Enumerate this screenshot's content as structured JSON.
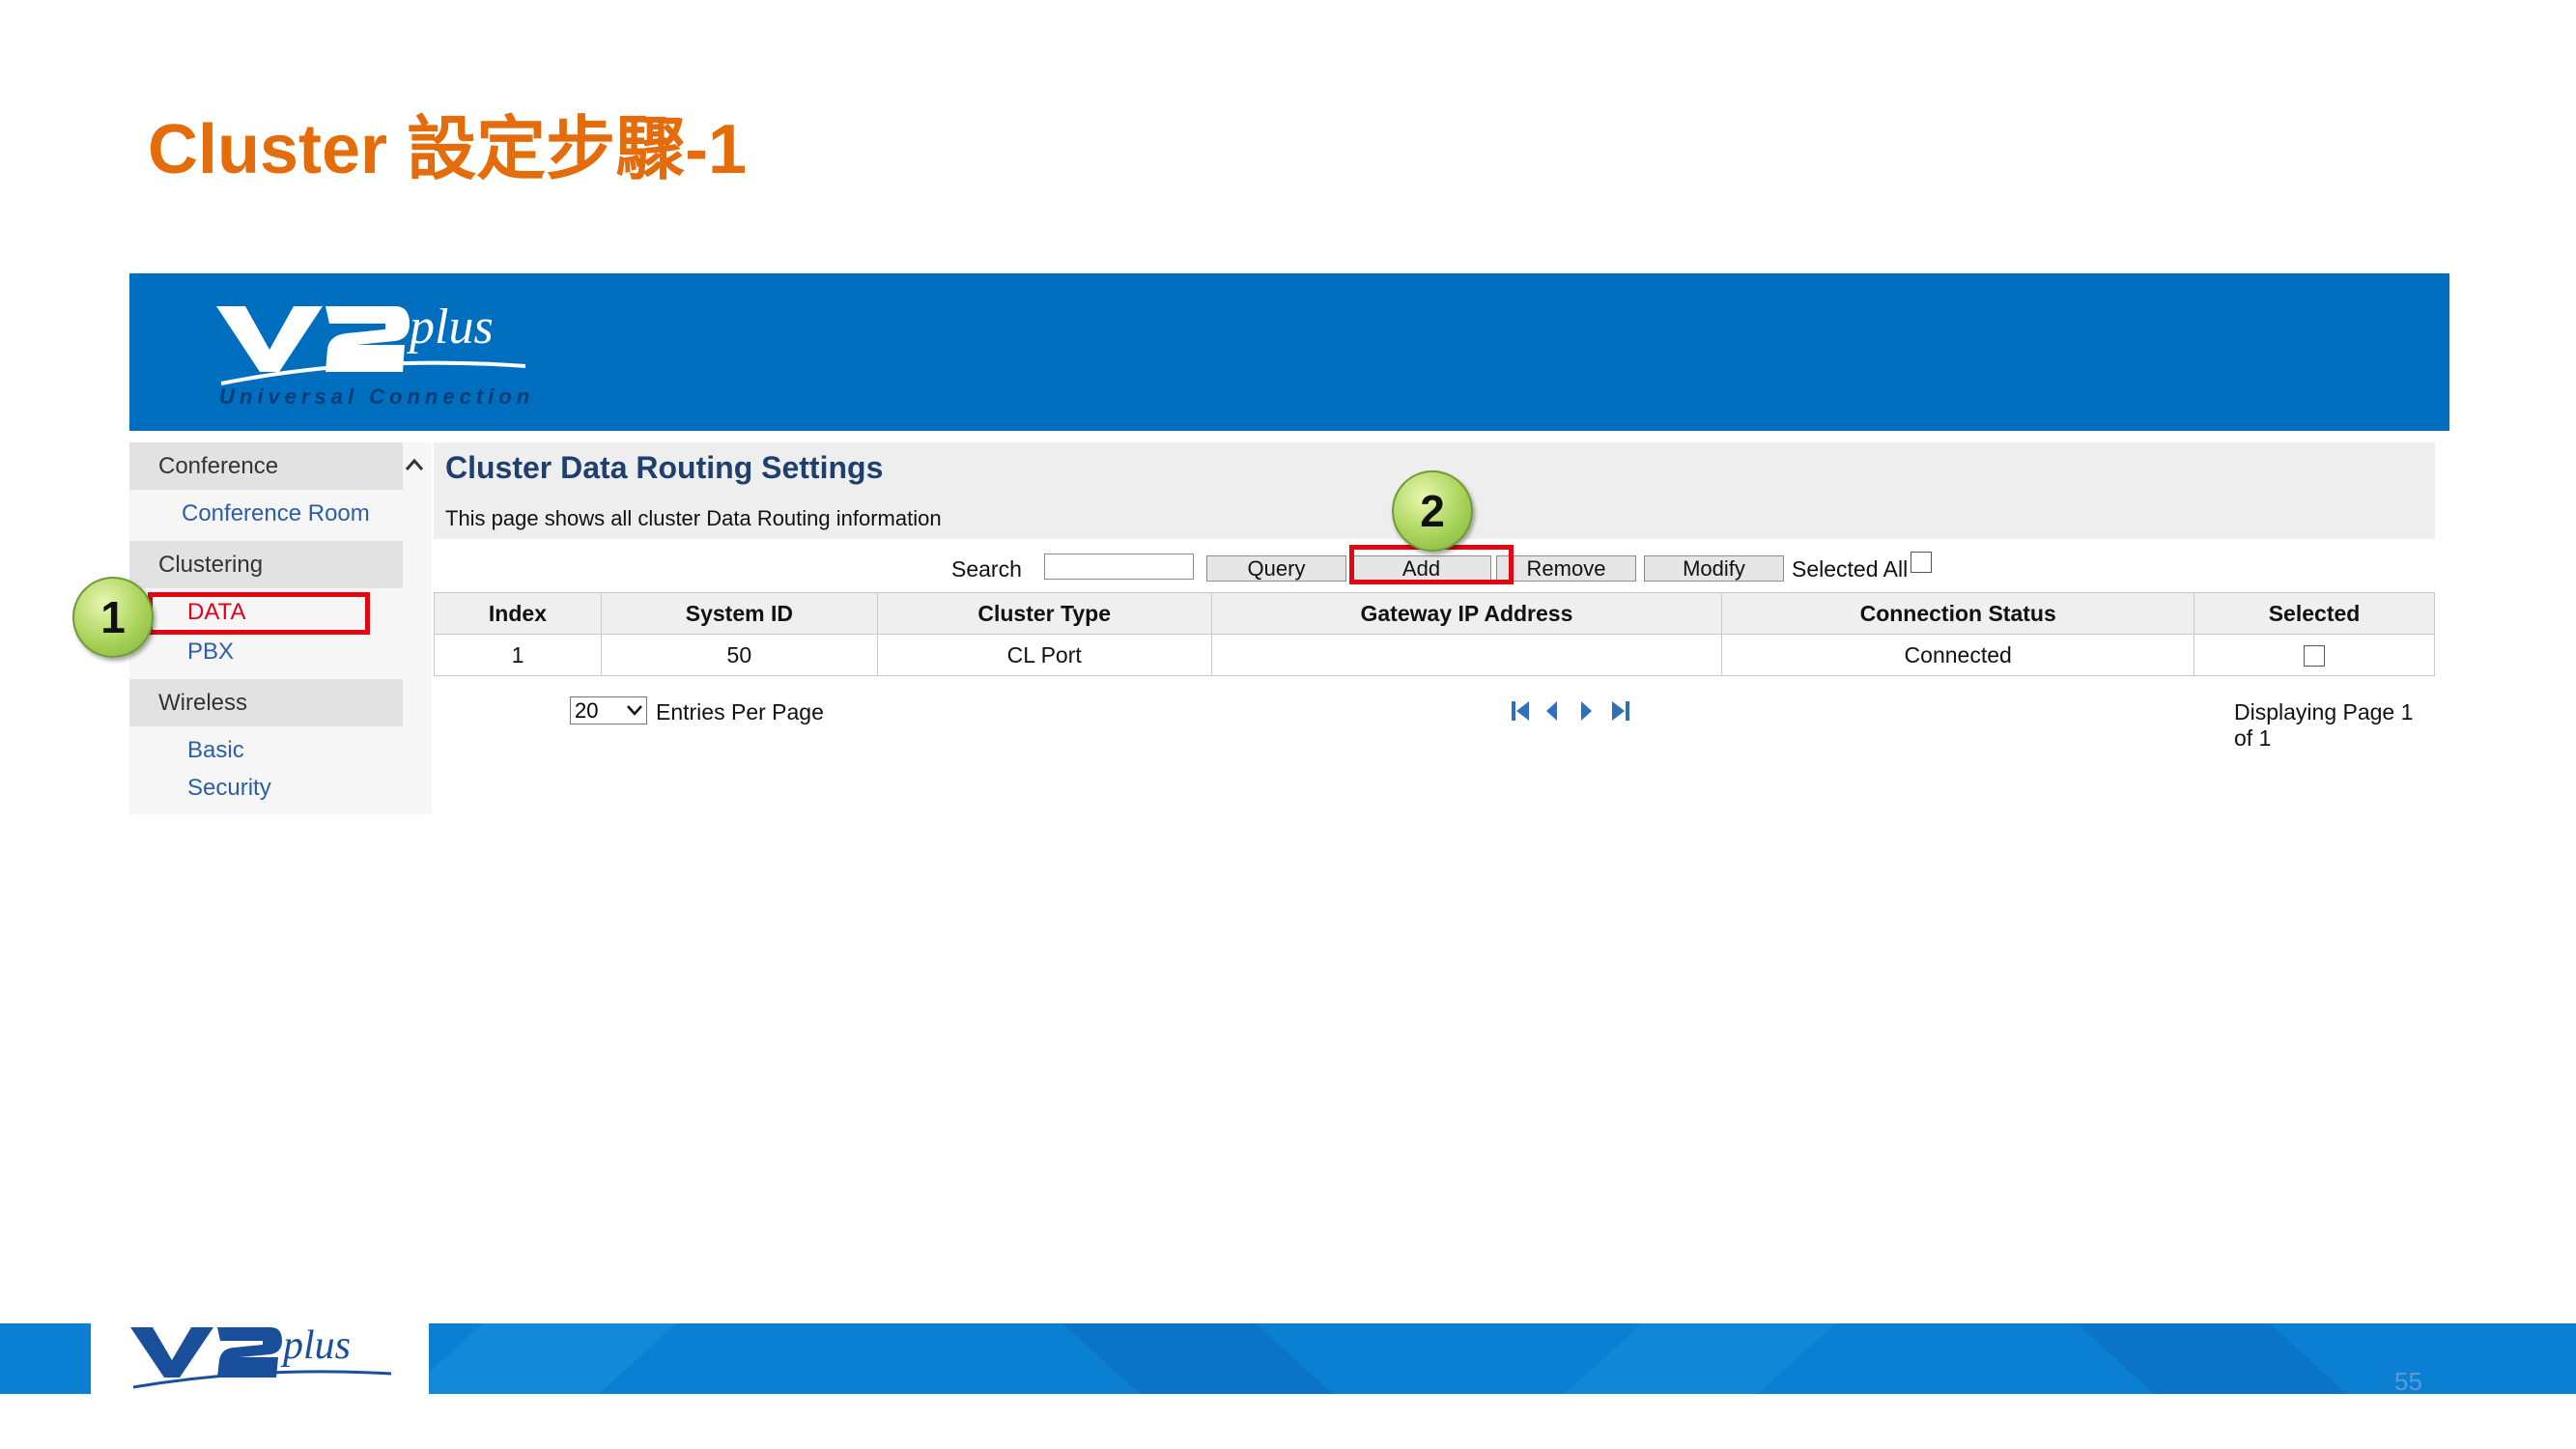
{
  "slide": {
    "title": "Cluster 設定步驟-1",
    "page_number": "55"
  },
  "banner": {
    "brand": "V2plus",
    "tagline": "Universal Connection",
    "color": "#006EBF"
  },
  "sidebar": {
    "sections": [
      {
        "label": "Conference",
        "items": [
          "Conference Room"
        ]
      },
      {
        "label": "Clustering",
        "items": [
          "DATA",
          "PBX"
        ]
      },
      {
        "label": "Wireless",
        "items": [
          "Basic",
          "Security"
        ]
      }
    ],
    "active_item": "DATA"
  },
  "content": {
    "title": "Cluster Data Routing Settings",
    "description": "This page shows all cluster Data Routing information"
  },
  "toolbar": {
    "search_label": "Search",
    "search_value": "",
    "query": "Query",
    "add": "Add",
    "remove": "Remove",
    "modify": "Modify",
    "select_all": "Selected All",
    "select_all_checked": false
  },
  "table": {
    "headers": [
      "Index",
      "System ID",
      "Cluster Type",
      "Gateway IP Address",
      "Connection Status",
      "Selected"
    ],
    "rows": [
      {
        "index": "1",
        "system_id": "50",
        "cluster_type": "CL Port",
        "gateway_ip": "",
        "status": "Connected",
        "selected": false
      }
    ]
  },
  "pagination": {
    "entries_value": "20",
    "entries_label": "Entries Per Page",
    "page_info": "Displaying Page 1 of 1"
  },
  "callouts": [
    "1",
    "2"
  ],
  "colors": {
    "title": "#E46C0A",
    "highlight": "#E30613",
    "link": "#2C5EA7",
    "connected": "#1A8A1A"
  }
}
